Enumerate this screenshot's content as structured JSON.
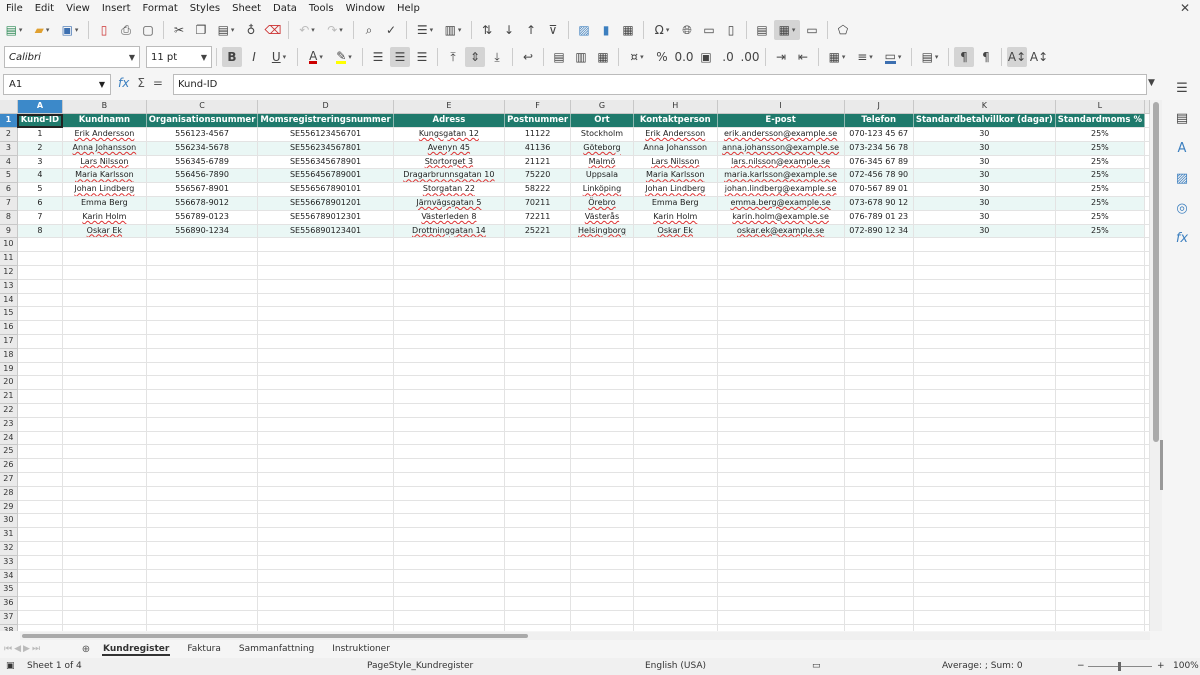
{
  "menu": [
    "File",
    "Edit",
    "View",
    "Insert",
    "Format",
    "Styles",
    "Sheet",
    "Data",
    "Tools",
    "Window",
    "Help"
  ],
  "font": {
    "name": "Calibri",
    "size": "11 pt"
  },
  "namebox": "A1",
  "formula": {
    "content": "Kund-ID",
    "sum_symbol": "Σ",
    "equals_symbol": "="
  },
  "columns": [
    "A",
    "B",
    "C",
    "D",
    "E",
    "F",
    "G",
    "H",
    "I",
    "J",
    "K",
    "L"
  ],
  "row_numbers": [
    "1",
    "2",
    "3",
    "4",
    "5",
    "6",
    "7",
    "8",
    "9",
    "10",
    "11",
    "12",
    "13",
    "14",
    "15",
    "16",
    "17",
    "18",
    "19",
    "20",
    "21",
    "22",
    "23",
    "24",
    "25",
    "26",
    "27",
    "28",
    "29",
    "30",
    "31",
    "32",
    "33",
    "34",
    "35",
    "36",
    "37",
    "38"
  ],
  "headers": [
    "Kund-ID",
    "Kundnamn",
    "Organisationsnummer",
    "Momsregistreringsnummer",
    "Adress",
    "Postnummer",
    "Ort",
    "Kontaktperson",
    "E-post",
    "Telefon",
    "Standardbetalvillkor (dagar)",
    "Standardmoms %"
  ],
  "rows": [
    [
      "1",
      "Erik Andersson",
      "556123-4567",
      "SE556123456701",
      "Kungsgatan 12",
      "11122",
      "Stockholm",
      "Erik Andersson",
      "erik.andersson@example.se",
      "070-123 45 67",
      "30",
      "25%"
    ],
    [
      "2",
      "Anna Johansson",
      "556234-5678",
      "SE556234567801",
      "Avenyn 45",
      "41136",
      "Göteborg",
      "Anna Johansson",
      "anna.johansson@example.se",
      "073-234 56 78",
      "30",
      "25%"
    ],
    [
      "3",
      "Lars Nilsson",
      "556345-6789",
      "SE556345678901",
      "Stortorget 3",
      "21121",
      "Malmö",
      "Lars Nilsson",
      "lars.nilsson@example.se",
      "076-345 67 89",
      "30",
      "25%"
    ],
    [
      "4",
      "Maria Karlsson",
      "556456-7890",
      "SE556456789001",
      "Dragarbrunnsgatan 10",
      "75220",
      "Uppsala",
      "Maria Karlsson",
      "maria.karlsson@example.se",
      "072-456 78 90",
      "30",
      "25%"
    ],
    [
      "5",
      "Johan Lindberg",
      "556567-8901",
      "SE556567890101",
      "Storgatan 22",
      "58222",
      "Linköping",
      "Johan Lindberg",
      "johan.lindberg@example.se",
      "070-567 89 01",
      "30",
      "25%"
    ],
    [
      "6",
      "Emma Berg",
      "556678-9012",
      "SE556678901201",
      "Järnvägsgatan 5",
      "70211",
      "Örebro",
      "Emma Berg",
      "emma.berg@example.se",
      "073-678 90 12",
      "30",
      "25%"
    ],
    [
      "7",
      "Karin Holm",
      "556789-0123",
      "SE556789012301",
      "Västerleden 8",
      "72211",
      "Västerås",
      "Karin Holm",
      "karin.holm@example.se",
      "076-789 01 23",
      "30",
      "25%"
    ],
    [
      "8",
      "Oskar Ek",
      "556890-1234",
      "SE556890123401",
      "Drottninggatan 14",
      "25221",
      "Helsingborg",
      "Oskar Ek",
      "oskar.ek@example.se",
      "072-890 12 34",
      "30",
      "25%"
    ]
  ],
  "spell_flags": [
    [
      false,
      true,
      false,
      false,
      true,
      false,
      false,
      true,
      true,
      false,
      false,
      false
    ],
    [
      false,
      true,
      false,
      false,
      true,
      false,
      true,
      false,
      true,
      false,
      false,
      false
    ],
    [
      false,
      true,
      false,
      false,
      true,
      false,
      true,
      true,
      true,
      false,
      false,
      false
    ],
    [
      false,
      true,
      false,
      false,
      true,
      false,
      false,
      true,
      true,
      false,
      false,
      false
    ],
    [
      false,
      true,
      false,
      false,
      true,
      false,
      true,
      true,
      true,
      false,
      false,
      false
    ],
    [
      false,
      false,
      false,
      false,
      true,
      false,
      true,
      false,
      true,
      false,
      false,
      false
    ],
    [
      false,
      true,
      false,
      false,
      true,
      false,
      true,
      true,
      true,
      false,
      false,
      false
    ],
    [
      false,
      true,
      false,
      false,
      true,
      false,
      true,
      true,
      true,
      false,
      false,
      false
    ]
  ],
  "tabs": [
    "Kundregister",
    "Faktura",
    "Sammanfattning",
    "Instruktioner"
  ],
  "active_tab": "Kundregister",
  "status": {
    "sheet": "Sheet 1 of 4",
    "page_style": "PageStyle_Kundregister",
    "language": "English (USA)",
    "sum": "Average: ; Sum: 0",
    "zoom": "100%"
  },
  "colors": {
    "header_bg": "#1f7a6c",
    "stripe": "#eaf7f5",
    "selection": "#3c89c9"
  }
}
